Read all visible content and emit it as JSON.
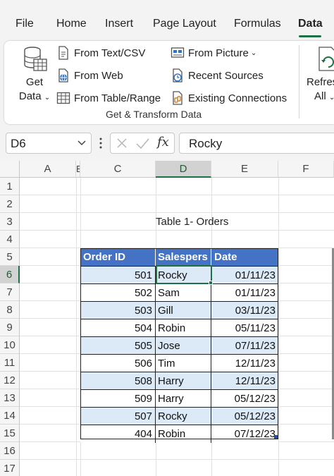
{
  "menu": {
    "tabs": [
      {
        "label": "File"
      },
      {
        "label": "Home"
      },
      {
        "label": "Insert"
      },
      {
        "label": "Page Layout"
      },
      {
        "label": "Formulas"
      },
      {
        "label": "Data",
        "active": true
      }
    ]
  },
  "ribbon": {
    "get_data": {
      "line1": "Get",
      "line2": "Data",
      "icon": "database-icon"
    },
    "commands": [
      {
        "label": "From Text/CSV",
        "icon": "text-file-icon"
      },
      {
        "label": "From Web",
        "icon": "web-globe-icon"
      },
      {
        "label": "From Table/Range",
        "icon": "table-icon"
      },
      {
        "label": "From Picture",
        "icon": "picture-icon",
        "has_dropdown": true
      },
      {
        "label": "Recent Sources",
        "icon": "recent-clock-icon"
      },
      {
        "label": "Existing Connections",
        "icon": "existing-connections-icon"
      }
    ],
    "group_label": "Get & Transform Data",
    "refresh": {
      "line1": "Refres",
      "line2": "All",
      "icon": "refresh-icon"
    }
  },
  "formula_bar": {
    "name_box": "D6",
    "cancel_icon": "x-icon",
    "enter_icon": "checkmark-icon",
    "fx_label": "fx",
    "content": "Rocky"
  },
  "grid": {
    "columns": [
      "A",
      "E",
      "C",
      "D",
      "E",
      "F"
    ],
    "rows": [
      "1",
      "2",
      "3",
      "4",
      "5",
      "6",
      "7",
      "8",
      "9",
      "10",
      "11",
      "12",
      "13",
      "14",
      "15",
      "16",
      "17"
    ],
    "selected_column": "D",
    "selected_row": "6",
    "table_title": "Table 1- Orders"
  },
  "table": {
    "headers": [
      "Order ID",
      "Salespers",
      "Date"
    ],
    "rows": [
      {
        "id": "501",
        "salesperson": "Rocky",
        "date": "01/11/23"
      },
      {
        "id": "502",
        "salesperson": "Sam",
        "date": "01/11/23"
      },
      {
        "id": "503",
        "salesperson": "Gill",
        "date": "03/11/23"
      },
      {
        "id": "504",
        "salesperson": "Robin",
        "date": "05/11/23"
      },
      {
        "id": "505",
        "salesperson": "Jose",
        "date": "07/11/23"
      },
      {
        "id": "506",
        "salesperson": "Tim",
        "date": "12/11/23"
      },
      {
        "id": "508",
        "salesperson": "Harry",
        "date": "12/11/23"
      },
      {
        "id": "509",
        "salesperson": "Harry",
        "date": "05/12/23"
      },
      {
        "id": "507",
        "salesperson": "Rocky",
        "date": "05/12/23"
      },
      {
        "id": "404",
        "salesperson": "Robin",
        "date": "07/12/23"
      }
    ],
    "colors": {
      "header": "#4472c4",
      "band": "#dce9f7",
      "plain": "#ffffff"
    }
  },
  "colors": {
    "accent": "#1e7145",
    "table_header": "#4472c4"
  }
}
